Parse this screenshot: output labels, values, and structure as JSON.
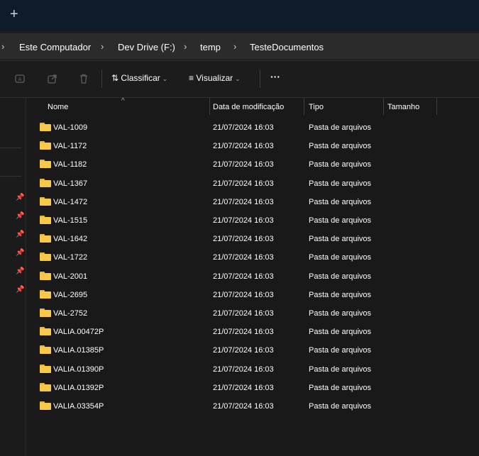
{
  "tabbar": {
    "new_tab_symbol": "+"
  },
  "breadcrumb": {
    "partial_chevron": "›",
    "items": [
      "Este Computador",
      "Dev Drive (F:)",
      "temp",
      "TesteDocumentos"
    ],
    "separator": "›"
  },
  "toolbar": {
    "icons": [
      "ai-icon",
      "share-icon",
      "delete-icon"
    ],
    "sort_label": "Classificar",
    "view_label": "Visualizar",
    "more_label": "···"
  },
  "columns": {
    "name": "Nome",
    "modified": "Data de modificação",
    "type": "Tipo",
    "size": "Tamanho",
    "sorted_by": "name"
  },
  "files": [
    {
      "name": "VAL-1009",
      "modified": "21/07/2024 16:03",
      "type": "Pasta de arquivos",
      "size": ""
    },
    {
      "name": "VAL-1172",
      "modified": "21/07/2024 16:03",
      "type": "Pasta de arquivos",
      "size": ""
    },
    {
      "name": "VAL-1182",
      "modified": "21/07/2024 16:03",
      "type": "Pasta de arquivos",
      "size": ""
    },
    {
      "name": "VAL-1367",
      "modified": "21/07/2024 16:03",
      "type": "Pasta de arquivos",
      "size": ""
    },
    {
      "name": "VAL-1472",
      "modified": "21/07/2024 16:03",
      "type": "Pasta de arquivos",
      "size": ""
    },
    {
      "name": "VAL-1515",
      "modified": "21/07/2024 16:03",
      "type": "Pasta de arquivos",
      "size": ""
    },
    {
      "name": "VAL-1642",
      "modified": "21/07/2024 16:03",
      "type": "Pasta de arquivos",
      "size": ""
    },
    {
      "name": "VAL-1722",
      "modified": "21/07/2024 16:03",
      "type": "Pasta de arquivos",
      "size": ""
    },
    {
      "name": "VAL-2001",
      "modified": "21/07/2024 16:03",
      "type": "Pasta de arquivos",
      "size": ""
    },
    {
      "name": "VAL-2695",
      "modified": "21/07/2024 16:03",
      "type": "Pasta de arquivos",
      "size": ""
    },
    {
      "name": "VAL-2752",
      "modified": "21/07/2024 16:03",
      "type": "Pasta de arquivos",
      "size": ""
    },
    {
      "name": "VALIA.00472P",
      "modified": "21/07/2024 16:03",
      "type": "Pasta de arquivos",
      "size": ""
    },
    {
      "name": "VALIA.01385P",
      "modified": "21/07/2024 16:03",
      "type": "Pasta de arquivos",
      "size": ""
    },
    {
      "name": "VALIA.01390P",
      "modified": "21/07/2024 16:03",
      "type": "Pasta de arquivos",
      "size": ""
    },
    {
      "name": "VALIA.01392P",
      "modified": "21/07/2024 16:03",
      "type": "Pasta de arquivos",
      "size": ""
    },
    {
      "name": "VALIA.03354P",
      "modified": "21/07/2024 16:03",
      "type": "Pasta de arquivos",
      "size": ""
    }
  ],
  "nav_pins": 6,
  "colors": {
    "background": "#191919",
    "folder": "#f7c948",
    "tabbar": "#0f1a2b"
  }
}
